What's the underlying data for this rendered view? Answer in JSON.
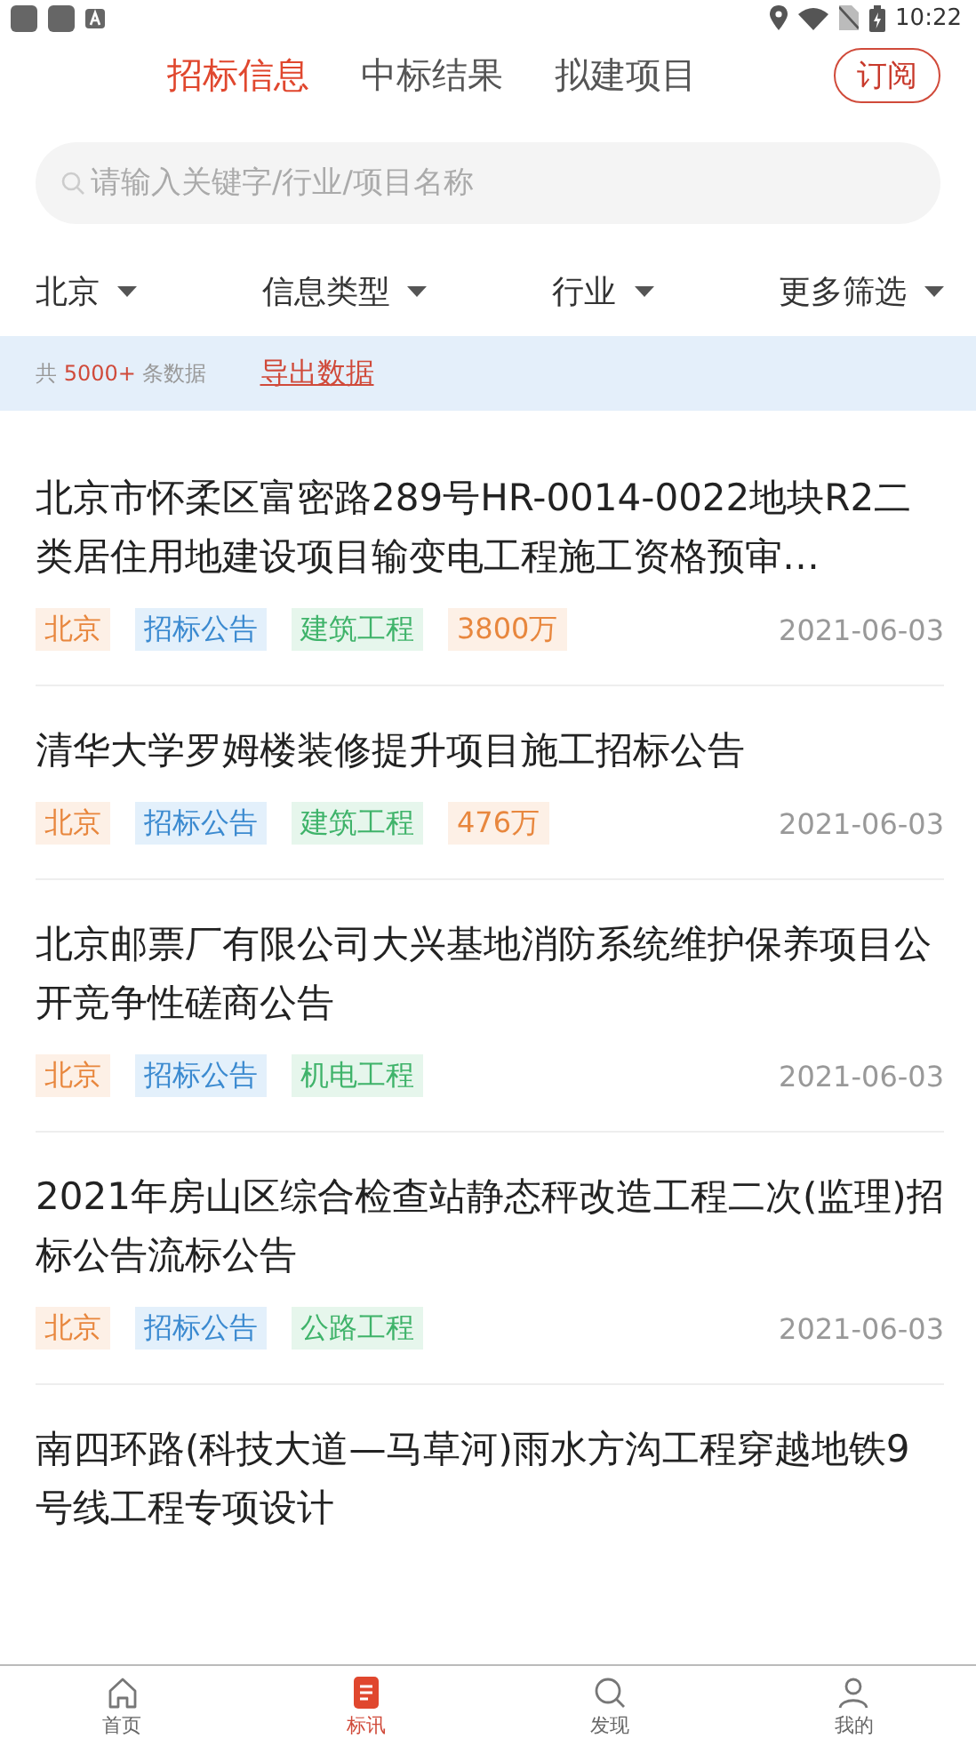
{
  "status_bar": {
    "time": "10:22"
  },
  "tabs": [
    {
      "label": "招标信息",
      "selected": true
    },
    {
      "label": "中标结果",
      "selected": false
    },
    {
      "label": "拟建项目",
      "selected": false
    }
  ],
  "subscribe_button": "订阅",
  "search": {
    "placeholder": "请输入关键字/行业/项目名称"
  },
  "filters": [
    "北京",
    "信息类型",
    "行业",
    "更多筛选"
  ],
  "summary": {
    "prefix": "共",
    "count": "5000+",
    "suffix": "条数据",
    "export_link": "导出数据"
  },
  "results": [
    {
      "title": "北京市怀柔区富密路289号HR-0014-0022地块R2二类居住用地建设项目输变电工程施工资格预审…",
      "tags": [
        {
          "kind": "region",
          "text": "北京"
        },
        {
          "kind": "type",
          "text": "招标公告"
        },
        {
          "kind": "industry",
          "text": "建筑工程"
        },
        {
          "kind": "amount",
          "text": "3800万"
        }
      ],
      "date": "2021-06-03"
    },
    {
      "title": "清华大学罗姆楼装修提升项目施工招标公告",
      "tags": [
        {
          "kind": "region",
          "text": "北京"
        },
        {
          "kind": "type",
          "text": "招标公告"
        },
        {
          "kind": "industry",
          "text": "建筑工程"
        },
        {
          "kind": "amount",
          "text": "476万"
        }
      ],
      "date": "2021-06-03"
    },
    {
      "title": "北京邮票厂有限公司大兴基地消防系统维护保养项目公开竞争性磋商公告",
      "tags": [
        {
          "kind": "region",
          "text": "北京"
        },
        {
          "kind": "type",
          "text": "招标公告"
        },
        {
          "kind": "industry",
          "text": "机电工程"
        }
      ],
      "date": "2021-06-03"
    },
    {
      "title": "2021年房山区综合检查站静态秤改造工程二次(监理)招标公告流标公告",
      "tags": [
        {
          "kind": "region",
          "text": "北京"
        },
        {
          "kind": "type",
          "text": "招标公告"
        },
        {
          "kind": "industry",
          "text": "公路工程"
        }
      ],
      "date": "2021-06-03"
    },
    {
      "title": "南四环路(科技大道—马草河)雨水方沟工程穿越地铁9号线工程专项设计"
    }
  ],
  "bottom_nav": [
    {
      "kind": "home",
      "label": "首页",
      "selected": false
    },
    {
      "kind": "doc",
      "label": "标讯",
      "selected": true
    },
    {
      "kind": "search",
      "label": "发现",
      "selected": false
    },
    {
      "kind": "user",
      "label": "我的",
      "selected": false
    }
  ]
}
